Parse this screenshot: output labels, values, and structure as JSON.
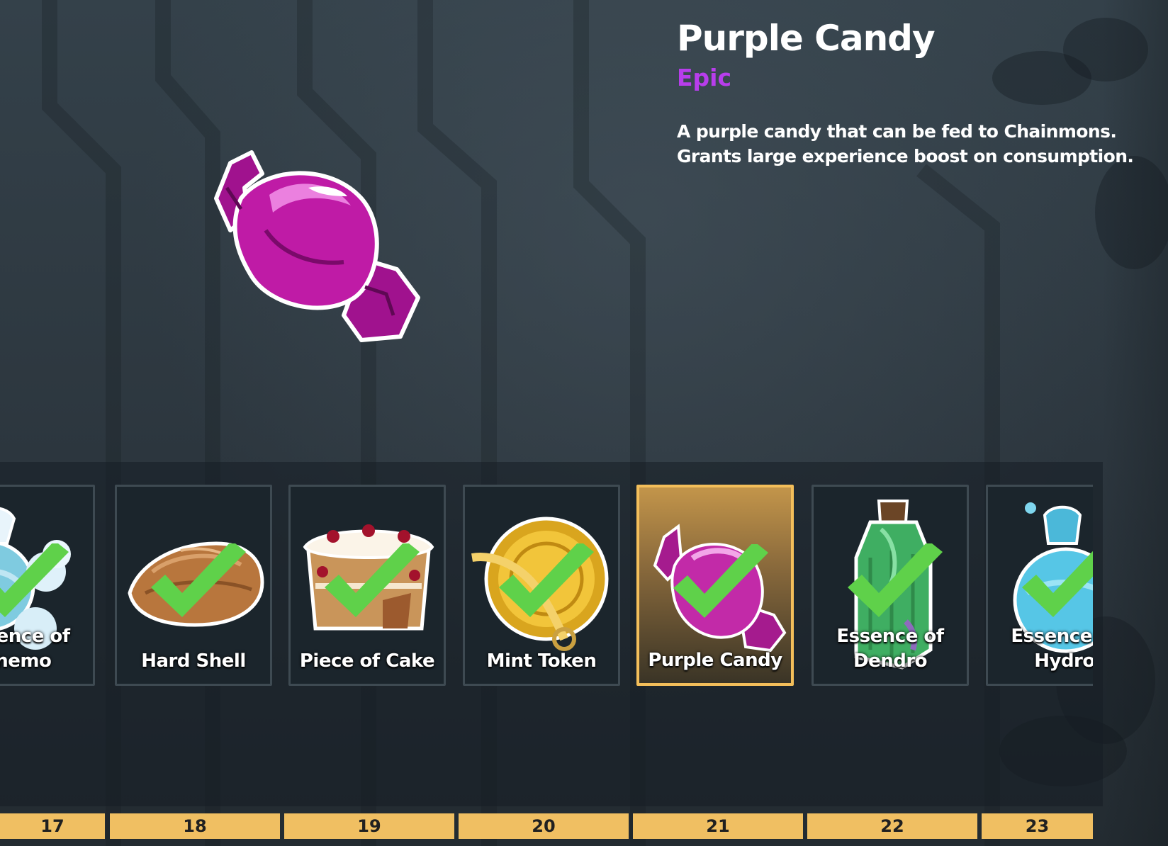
{
  "item": {
    "name": "Purple Candy",
    "rarity": "Epic",
    "description_lines": [
      "A purple candy that can be fed to Chainmons.",
      "Grants large experience boost on consumption."
    ]
  },
  "colors": {
    "rarity_epic": "#b83dec",
    "selected_border": "#f3be5a",
    "level_bar": "#f0bf62",
    "check": "#5fd14a"
  },
  "rewards": [
    {
      "label_lines": [
        "Essence of",
        "Anemo"
      ],
      "level": "17",
      "claimed": true,
      "icon": "anemo-essence-icon"
    },
    {
      "label_lines": [
        "Hard Shell"
      ],
      "level": "18",
      "claimed": true,
      "icon": "hard-shell-icon"
    },
    {
      "label_lines": [
        "Piece of Cake"
      ],
      "level": "19",
      "claimed": true,
      "icon": "cake-icon"
    },
    {
      "label_lines": [
        "Mint Token"
      ],
      "level": "20",
      "claimed": true,
      "icon": "mint-token-icon"
    },
    {
      "label_lines": [
        "Purple Candy"
      ],
      "level": "21",
      "claimed": true,
      "selected": true,
      "icon": "purple-candy-icon"
    },
    {
      "label_lines": [
        "Essence of",
        "Dendro"
      ],
      "level": "22",
      "claimed": true,
      "icon": "dendro-essence-icon"
    },
    {
      "label_lines": [
        "Essence of",
        "Hydro"
      ],
      "level": "23",
      "claimed": true,
      "icon": "hydro-essence-icon"
    }
  ]
}
